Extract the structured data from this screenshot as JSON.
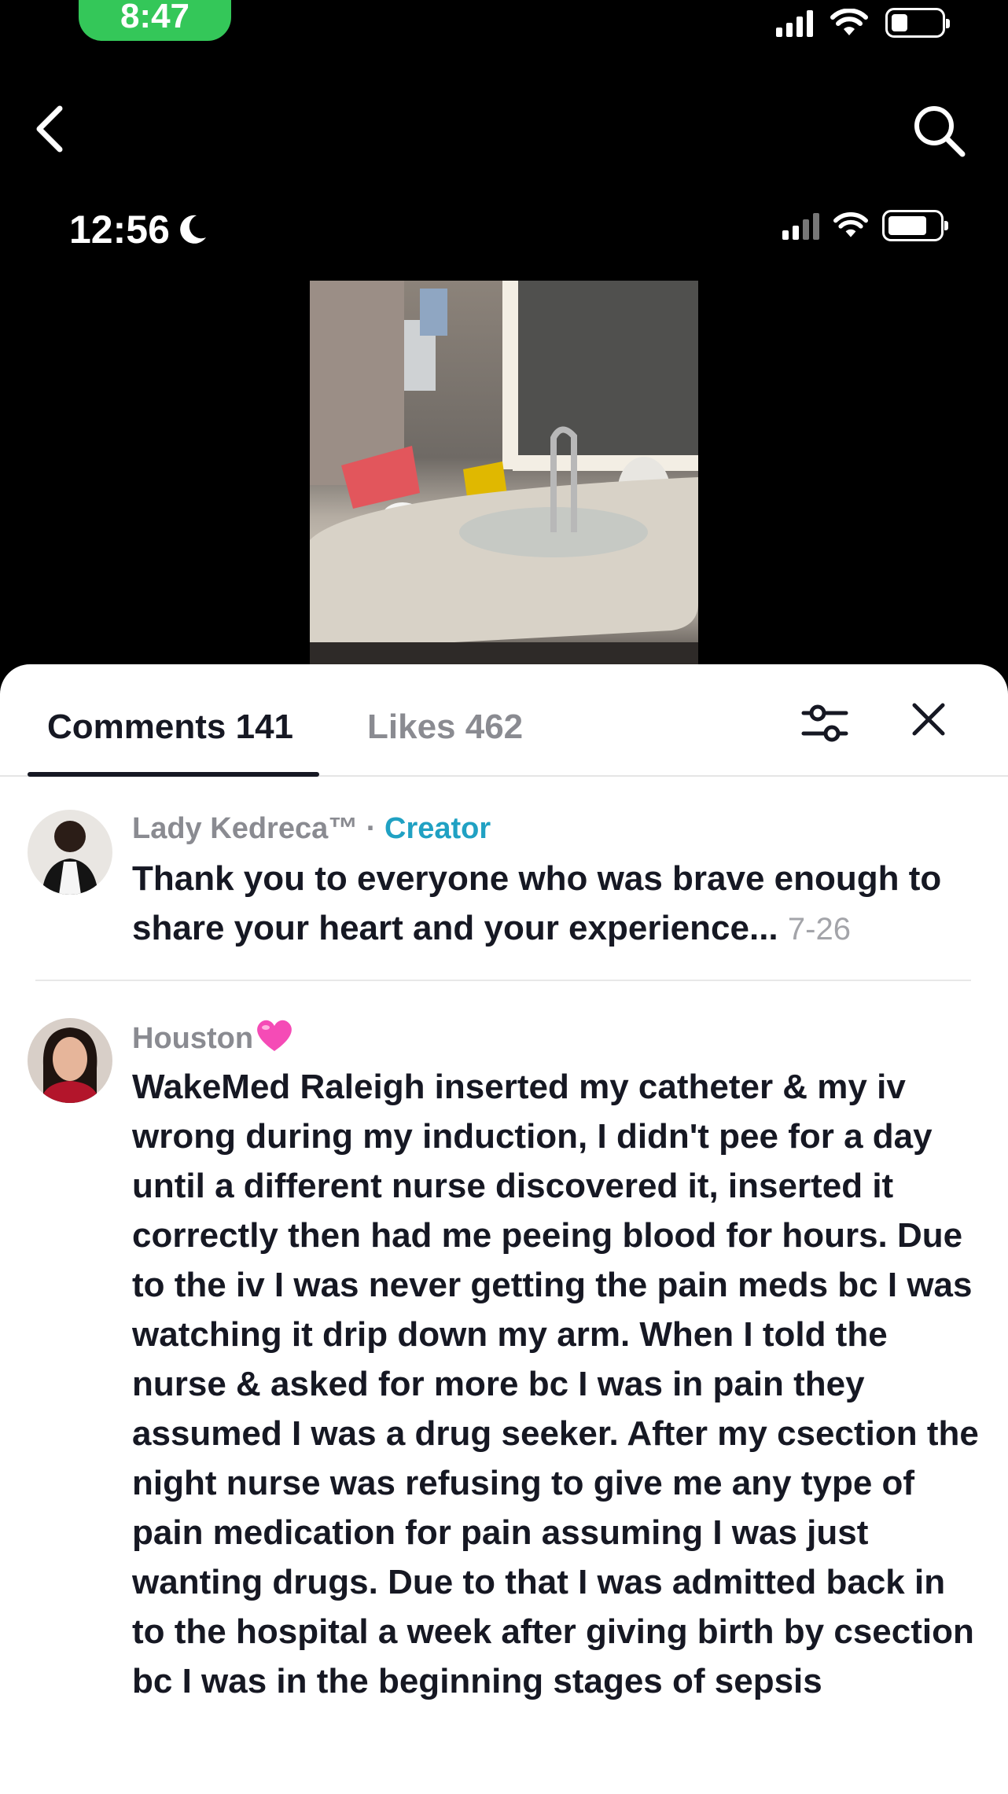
{
  "status_bar": {
    "time": "8:47"
  },
  "embedded_status": {
    "time": "12:56"
  },
  "tabs": [
    {
      "label": "Comments 141",
      "active": true
    },
    {
      "label": "Likes 462",
      "active": false
    }
  ],
  "comments": [
    {
      "author": "Lady Kedreca™",
      "separator": " · ",
      "badge": "Creator",
      "text": "Thank you to everyone who was brave enough to share your heart and your experience...",
      "date": "7-26"
    },
    {
      "author": "Houston",
      "author_emoji": "pink-heart-icon",
      "text": "WakeMed Raleigh inserted my catheter & my iv wrong during my induction, I didn't pee for a day until a different nurse discovered it, inserted it correctly then had me peeing blood for hours. Due to the iv I was never getting the pain meds bc I was watching it drip down my arm. When I told the nurse & asked for more bc I was in pain they assumed I was a drug seeker. After my csection the night nurse was refusing to give me any type of pain medication for pain assuming I was just wanting drugs. Due to that I was admitted back in to the hospital a week after giving birth by csection bc I was in the beginning stages of sepsis"
    }
  ],
  "colors": {
    "status_pill": "#34c759",
    "creator_badge": "#20a1c3",
    "text_primary": "#161823",
    "text_secondary": "#8a8b91"
  },
  "icons": [
    "back-icon",
    "search-icon",
    "filter-icon",
    "close-icon",
    "moon-icon",
    "signal-icon",
    "wifi-icon",
    "battery-icon"
  ]
}
